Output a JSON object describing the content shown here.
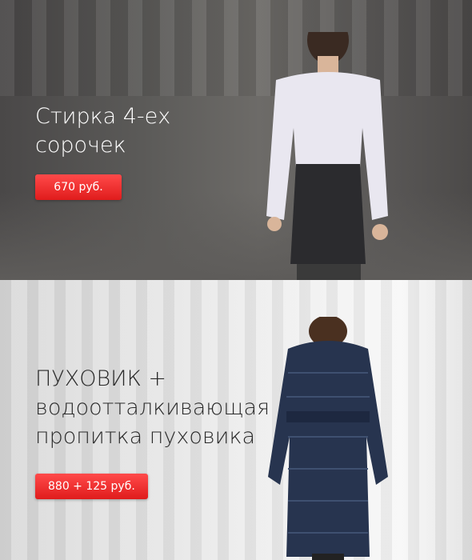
{
  "banners": [
    {
      "title_line1": "Стирка 4-ех",
      "title_line2": "сорочек",
      "price": "670 руб."
    },
    {
      "title_line1": "ПУХОВИК +",
      "title_line2": "водоотталкивающая",
      "title_line3": "пропитка пуховика",
      "price": "880 + 125 руб."
    }
  ],
  "colors": {
    "accent": "#e8262a"
  }
}
